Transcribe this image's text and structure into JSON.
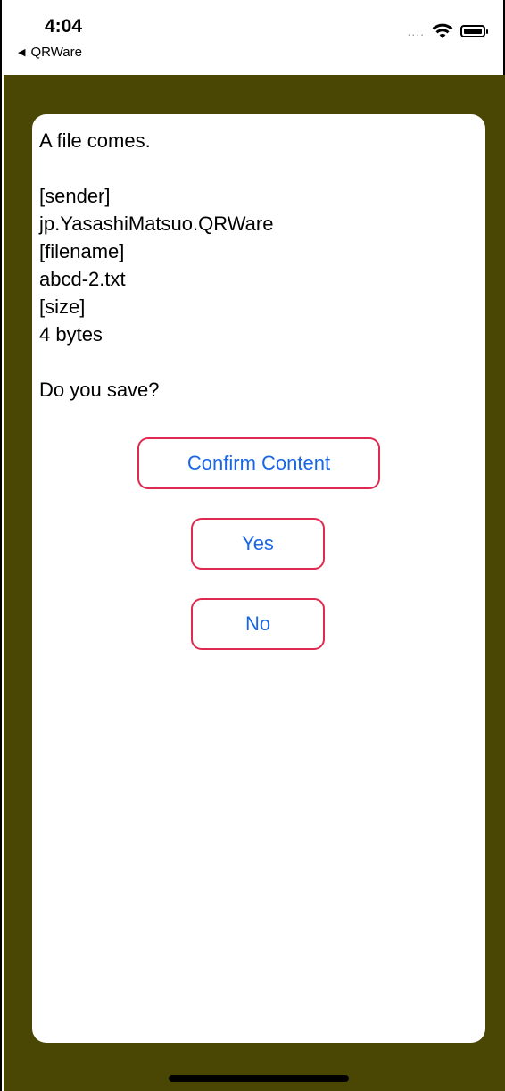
{
  "status_bar": {
    "time": "4:04",
    "back_label": "QRWare",
    "signal": "....",
    "icons": [
      "wifi-icon",
      "battery-icon"
    ]
  },
  "dialog": {
    "message": "A file comes.\n\n[sender]\njp.YasashiMatsuo.QRWare\n[filename]\nabcd-2.txt\n[size]\n4 bytes\n\nDo you save?",
    "buttons": {
      "confirm": "Confirm Content",
      "yes": "Yes",
      "no": "No"
    }
  },
  "colors": {
    "background": "#4a4705",
    "button_border": "#e0294f",
    "button_text": "#1a66e6"
  }
}
